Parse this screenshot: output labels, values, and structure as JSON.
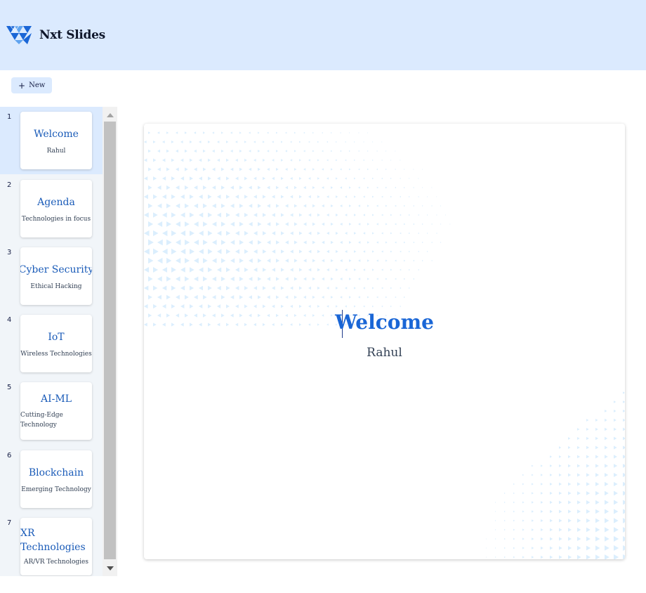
{
  "app": {
    "name": "Nxt Slides",
    "logo_icon": "nxt-slides-logo-icon",
    "accent": "#1a66d6",
    "header_bg": "#dbeafe"
  },
  "toolbar": {
    "new_icon": "+",
    "new_label": "New"
  },
  "slides": [
    {
      "number": "1",
      "title": "Welcome",
      "subtitle": "Rahul",
      "active": true
    },
    {
      "number": "2",
      "title": "Agenda",
      "subtitle": "Technologies in focus"
    },
    {
      "number": "3",
      "title": "Cyber Security",
      "subtitle": "Ethical Hacking"
    },
    {
      "number": "4",
      "title": "IoT",
      "subtitle": "Wireless Technologies"
    },
    {
      "number": "5",
      "title": "AI-ML",
      "subtitle": "Cutting-Edge Technology"
    },
    {
      "number": "6",
      "title": "Blockchain",
      "subtitle": "Emerging Technology"
    },
    {
      "number": "7",
      "title": "XR Technologies",
      "subtitle": "AR/VR Technologies"
    }
  ],
  "editor": {
    "title": "Welcome",
    "subtitle": "Rahul",
    "background_pattern": "triangle-mosaic",
    "pattern_color": "#dbeefd"
  }
}
